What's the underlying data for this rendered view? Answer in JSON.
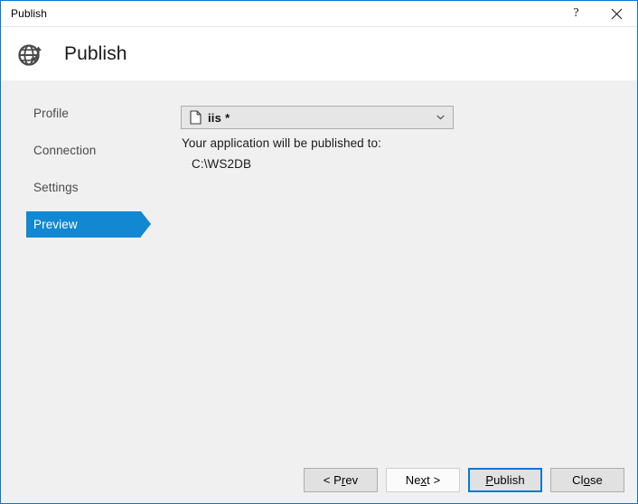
{
  "window": {
    "title": "Publish",
    "controls": [
      {
        "name": "help-button",
        "glyph": "?"
      },
      {
        "name": "close-button",
        "glyph": "✕"
      }
    ]
  },
  "header": {
    "title": "Publish",
    "icon": "globe-publish-icon"
  },
  "sidebar": {
    "items": [
      {
        "label": "Profile",
        "selected": false
      },
      {
        "label": "Connection",
        "selected": false
      },
      {
        "label": "Settings",
        "selected": false
      },
      {
        "label": "Preview",
        "selected": true
      }
    ],
    "selected_color": "#1287d2"
  },
  "main": {
    "profile_select": {
      "icon": "document-icon",
      "value": "iis",
      "dirty_marker": "*",
      "chevron": "chevron-down-icon"
    },
    "publish_target_label": "Your application will be published to:",
    "publish_target_path": "C:\\WS2DB"
  },
  "footer": {
    "buttons": [
      {
        "name": "prev-button",
        "pre": "< P",
        "accel": "r",
        "post": "ev",
        "style": "default",
        "label": "< Prev"
      },
      {
        "name": "next-button",
        "pre": "Ne",
        "accel": "x",
        "post": "t >",
        "style": "light",
        "label": "Next >"
      },
      {
        "name": "publish-button",
        "pre": "",
        "accel": "P",
        "post": "ublish",
        "style": "focused",
        "label": "Publish"
      },
      {
        "name": "close-button",
        "pre": "Cl",
        "accel": "o",
        "post": "se",
        "style": "default",
        "label": "Close"
      }
    ]
  },
  "colors": {
    "accent": "#0078d7",
    "selection": "#1287d2",
    "body_bg": "#f0f0f0",
    "header_bg": "#ffffff"
  }
}
